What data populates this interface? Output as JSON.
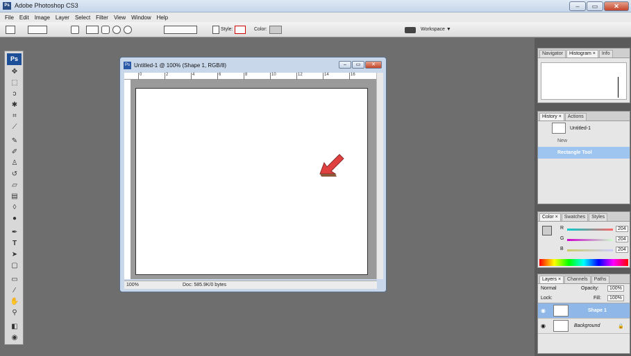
{
  "app": {
    "title": "Adobe Photoshop CS3",
    "icon_text": "Ps",
    "window_buttons": [
      "–",
      "▭",
      "✕"
    ]
  },
  "menu": [
    "File",
    "Edit",
    "Image",
    "Layer",
    "Select",
    "Filter",
    "View",
    "Window",
    "Help"
  ],
  "options_bar": {
    "style_label": "Style:",
    "color_label": "Color:",
    "color_value": "#cccccc",
    "workspace_label": "Workspace ▼"
  },
  "toolbox": {
    "logo": "Ps",
    "tools": [
      "move-tool",
      "marquee-tool",
      "lasso-tool",
      "magic-wand-tool",
      "crop-tool",
      "slice-tool",
      "healing-brush-tool",
      "brush-tool",
      "clone-stamp-tool",
      "history-brush-tool",
      "eraser-tool",
      "gradient-tool",
      "blur-tool",
      "dodge-tool",
      "pen-tool",
      "type-tool",
      "path-selection-tool",
      "shape-tool",
      "notes-tool",
      "eyedropper-tool",
      "hand-tool",
      "zoom-tool"
    ]
  },
  "document": {
    "title": "Untitled-1 @ 100% (Shape 1, RGB/8)",
    "ruler_labels": [
      "0",
      "2",
      "4",
      "6",
      "8",
      "10",
      "12",
      "14",
      "16"
    ],
    "zoom": "100%",
    "doc_info": "Doc: 585.9K/0 bytes"
  },
  "panels": {
    "navigator_tabs": [
      "Navigator",
      "Histogram ×",
      "Info"
    ],
    "history_tabs": [
      "History ×",
      "Actions"
    ],
    "history_snapshot": "Untitled-1",
    "history_items": [
      "New",
      "Rectangle Tool"
    ],
    "color_tabs": [
      "Color ×",
      "Swatches",
      "Styles"
    ],
    "color_sliders": [
      {
        "label": "R",
        "value": "204"
      },
      {
        "label": "G",
        "value": "204"
      },
      {
        "label": "B",
        "value": "204"
      }
    ],
    "layers_tabs": [
      "Layers ×",
      "Channels",
      "Paths"
    ],
    "blend_mode": "Normal",
    "opacity_label": "Opacity:",
    "opacity_value": "100%",
    "lock_label": "Lock:",
    "fill_label": "Fill:",
    "fill_value": "100%",
    "layers": [
      "Shape 1",
      "Background"
    ]
  }
}
